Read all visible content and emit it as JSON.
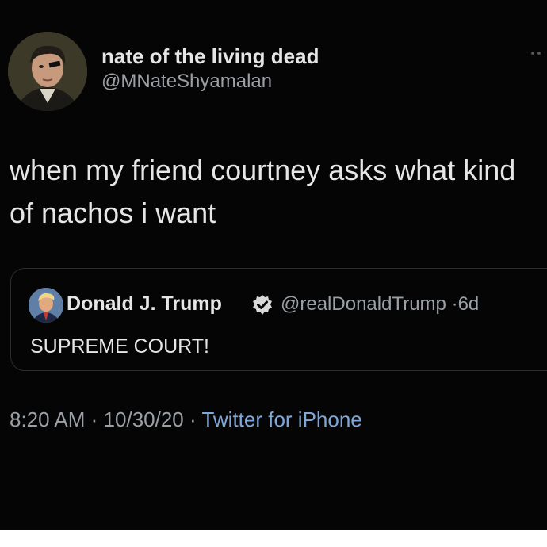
{
  "author": {
    "display_name": "nate of the living dead",
    "handle": "@MNateShyamalan",
    "avatar_icon": "portrait-avatar-icon"
  },
  "tweet": {
    "text": "when my friend courtney asks what kind of nachos i want"
  },
  "quoted_tweet": {
    "display_name": "Donald J. Trump",
    "verified_icon": "verified-badge-icon",
    "handle": "@realDonaldTrump",
    "separator": "·",
    "age": "6d",
    "text": "SUPREME COURT!"
  },
  "footer": {
    "time": "8:20 AM",
    "date": "10/30/20",
    "separator": "·",
    "source": "Twitter for iPhone"
  },
  "colors": {
    "background": "#050505",
    "text": "#e6e6e6",
    "muted": "#9aa0a6",
    "link": "#7fa7d9",
    "border": "#2c2c2c"
  }
}
